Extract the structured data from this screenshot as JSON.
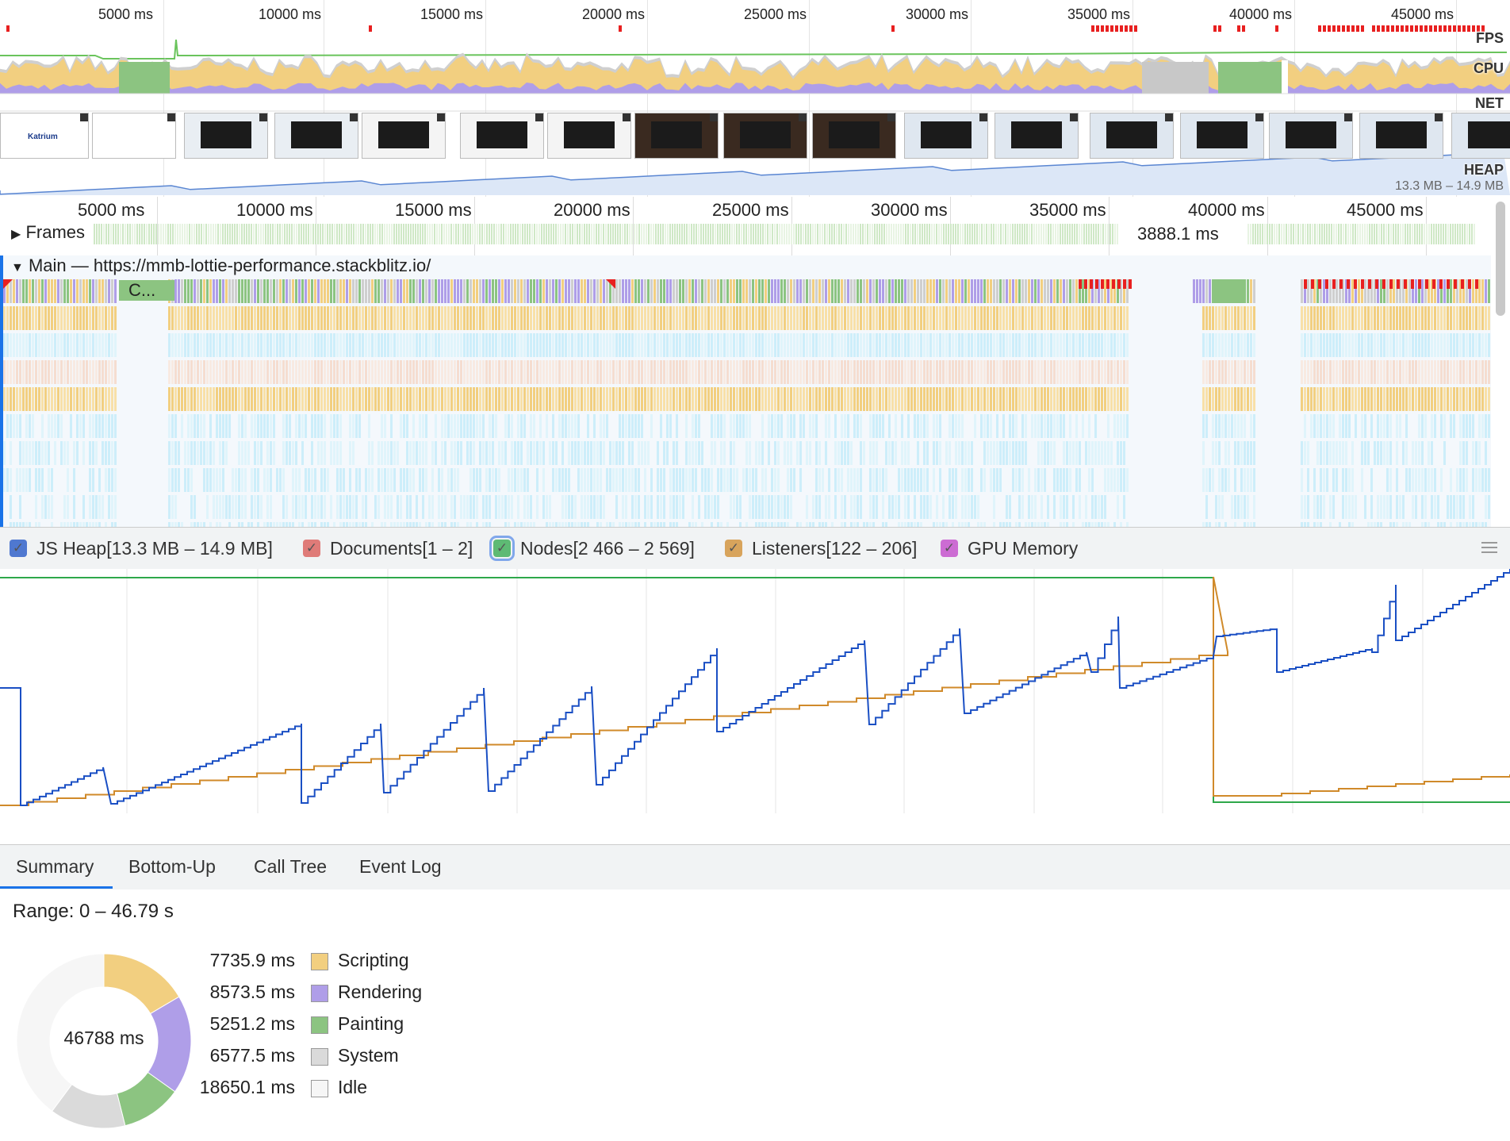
{
  "overview": {
    "ticks": [
      "5000 ms",
      "10000 ms",
      "15000 ms",
      "20000 ms",
      "25000 ms",
      "30000 ms",
      "35000 ms",
      "40000 ms",
      "45000 ms"
    ],
    "labels": {
      "fps": "FPS",
      "cpu": "CPU",
      "net": "NET",
      "heap": "HEAP"
    },
    "heap_range": "13.3 MB – 14.9 MB",
    "film_first_logo": "Katrium"
  },
  "timeline": {
    "ticks": [
      "5000 ms",
      "10000 ms",
      "15000 ms",
      "20000 ms",
      "25000 ms",
      "30000 ms",
      "35000 ms",
      "40000 ms",
      "45000 ms"
    ],
    "frames_label": "Frames",
    "frame_duration": "3888.1 ms",
    "main_label": "Main — https://mmb-lottie-performance.stackblitz.io/",
    "truncated_task": "C..."
  },
  "counters": {
    "items": [
      {
        "label": "JS Heap[13.3 MB – 14.9 MB]",
        "color": "#1a4fc4",
        "checked": true
      },
      {
        "label": "Documents[1 – 2]",
        "color": "#d9534f",
        "checked": true
      },
      {
        "label": "Nodes[2 466 – 2 569]",
        "color": "#2ea84a",
        "checked": true
      },
      {
        "label": "Listeners[122 – 206]",
        "color": "#d08a2a",
        "checked": true
      },
      {
        "label": "GPU Memory",
        "color": "#c040c8",
        "checked": true
      }
    ]
  },
  "tabs": [
    "Summary",
    "Bottom-Up",
    "Call Tree",
    "Event Log"
  ],
  "active_tab": "Summary",
  "summary": {
    "range": "Range: 0 – 46.79 s",
    "total": "46788 ms",
    "items": [
      {
        "value": "7735.9 ms",
        "name": "Scripting",
        "color": "#f2cf80",
        "ms": 7735.9
      },
      {
        "value": "8573.5 ms",
        "name": "Rendering",
        "color": "#af9ee8",
        "ms": 8573.5
      },
      {
        "value": "5251.2 ms",
        "name": "Painting",
        "color": "#8cc481",
        "ms": 5251.2
      },
      {
        "value": "6577.5 ms",
        "name": "System",
        "color": "#dadada",
        "ms": 6577.5
      },
      {
        "value": "18650.1 ms",
        "name": "Idle",
        "color": "#f6f6f6",
        "ms": 18650.1
      }
    ]
  }
}
